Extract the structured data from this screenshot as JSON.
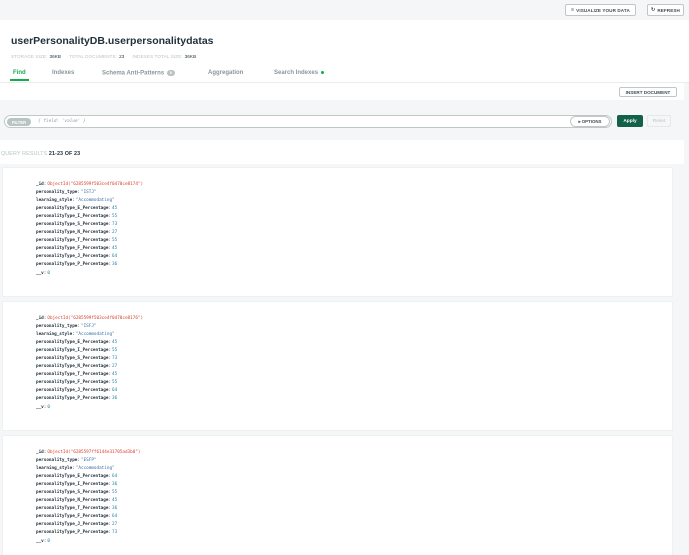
{
  "toolbar": {
    "visualize_label": "VISUALIZE YOUR DATA",
    "visualize_icon": "bar-chart-icon",
    "refresh_label": "REFRESH",
    "refresh_icon": "refresh-icon"
  },
  "namespace": {
    "title": "userPersonalityDB.userpersonalitydatas",
    "stats": [
      {
        "label": "STORAGE SIZE:",
        "value": "36KB"
      },
      {
        "label": "TOTAL DOCUMENTS:",
        "value": "23"
      },
      {
        "label": "INDEXES TOTAL SIZE:",
        "value": "36KB"
      }
    ]
  },
  "tabs": [
    {
      "label": "Find",
      "active": true
    },
    {
      "label": "Indexes"
    },
    {
      "label": "Schema Anti-Patterns",
      "badge": "0"
    },
    {
      "label": "Aggregation"
    },
    {
      "label": "Search Indexes"
    }
  ],
  "actions": {
    "insert_label": "INSERT DOCUMENT"
  },
  "filter": {
    "chip_label": "FILTER",
    "placeholder": "{ field: 'value' }",
    "options_label": "OPTIONS",
    "apply_label": "Apply",
    "reset_label": "Reset"
  },
  "results": {
    "prefix": "QUERY RESULTS",
    "range": "21-23 OF 23"
  },
  "documents": [
    {
      "id": "ObjectId(\"6285599f503ce4f0470ce8174\")",
      "personality_type": "\"ISTJ\"",
      "learning_style": "\"Accommodating\"",
      "E": "45",
      "I": "55",
      "S": "73",
      "N": "27",
      "T": "55",
      "F": "45",
      "J": "64",
      "P": "36",
      "v": "0"
    },
    {
      "id": "ObjectId(\"6285599f503ce4f0470ce8176\")",
      "personality_type": "\"ISFJ\"",
      "learning_style": "\"Accommodating\"",
      "E": "45",
      "I": "55",
      "S": "73",
      "N": "27",
      "T": "45",
      "F": "55",
      "J": "64",
      "P": "36",
      "v": "0"
    },
    {
      "id": "ObjectId(\"6285597ff6144e31705ad3b0\")",
      "personality_type": "\"ESFP\"",
      "learning_style": "\"Accommodating\"",
      "E": "64",
      "I": "36",
      "S": "55",
      "N": "45",
      "T": "36",
      "F": "64",
      "J": "27",
      "P": "73",
      "v": "0"
    }
  ]
}
